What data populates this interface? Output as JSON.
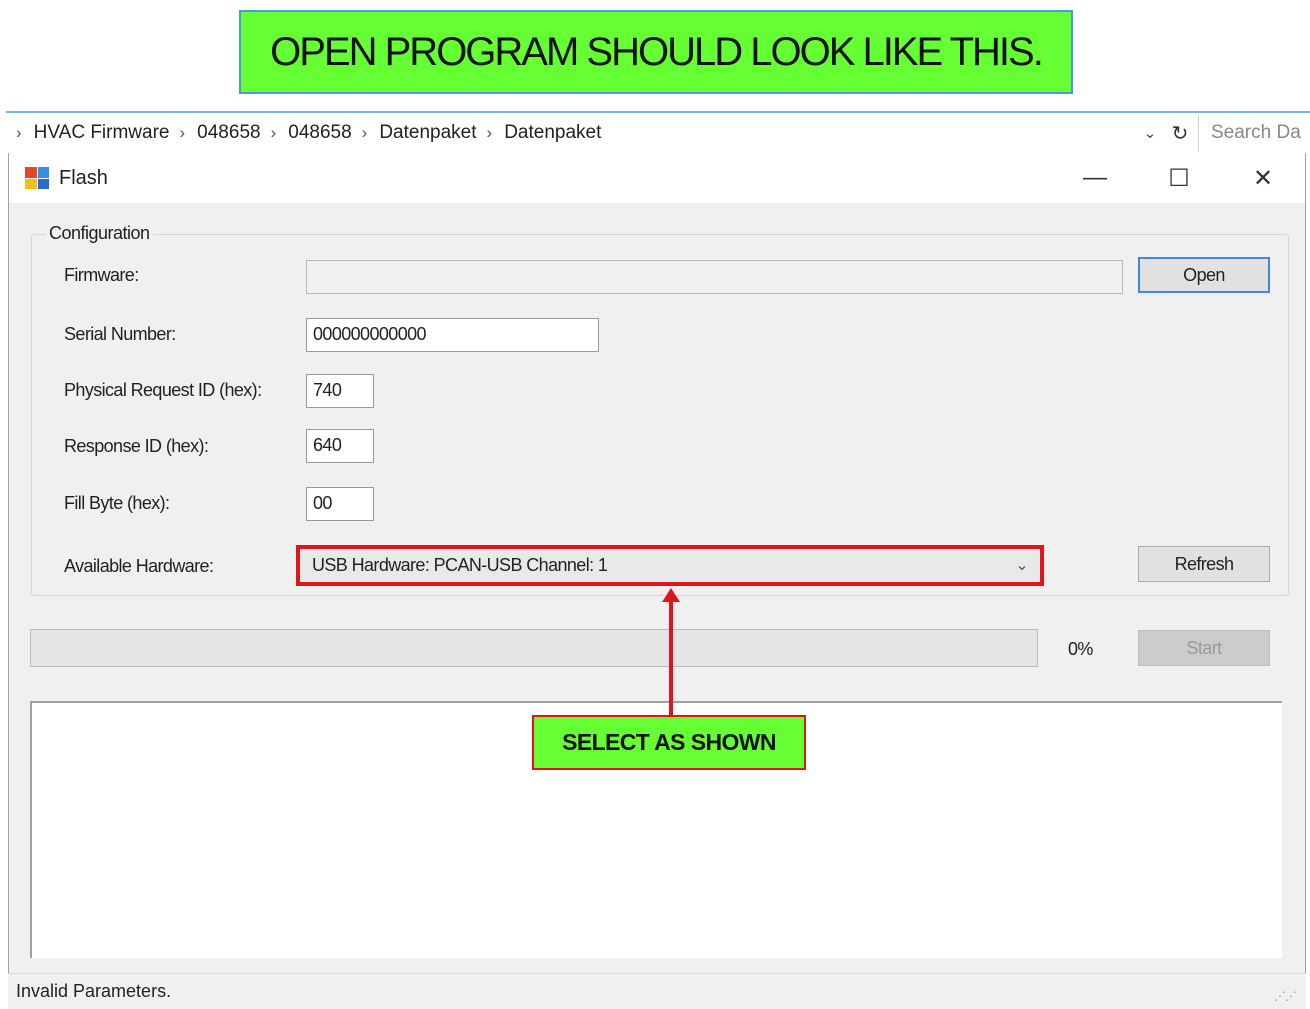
{
  "banner": {
    "text": "OPEN PROGRAM SHOULD LOOK LIKE THIS."
  },
  "explorer": {
    "breadcrumb": [
      "HVAC Firmware",
      "048658",
      "048658",
      "Datenpaket",
      "Datenpaket"
    ],
    "search_placeholder": "Search Da"
  },
  "window": {
    "title": "Flash",
    "icons": {
      "app": "app-icon",
      "minimize": "minimize-icon",
      "maximize": "maximize-icon",
      "close": "close-icon"
    }
  },
  "config": {
    "group_label": "Configuration",
    "firmware_label": "Firmware:",
    "firmware_value": "",
    "open_button": "Open",
    "serial_label": "Serial Number:",
    "serial_value": "000000000000",
    "phys_req_label": "Physical Request ID (hex):",
    "phys_req_value": "740",
    "response_label": "Response ID (hex):",
    "response_value": "640",
    "fill_label": "Fill Byte (hex):",
    "fill_value": "00",
    "hardware_label": "Available Hardware:",
    "hardware_selected": "USB Hardware: PCAN-USB Channel: 1",
    "refresh_button": "Refresh"
  },
  "progress": {
    "percent_text": "0%",
    "value": 0,
    "start_button": "Start"
  },
  "annotation": {
    "callout_text": "SELECT AS SHOWN"
  },
  "status": {
    "text": "Invalid Parameters."
  },
  "colors": {
    "banner_green": "#66ff33",
    "highlight_red": "#e0141c",
    "default_button_blue": "#3c8ad8"
  }
}
